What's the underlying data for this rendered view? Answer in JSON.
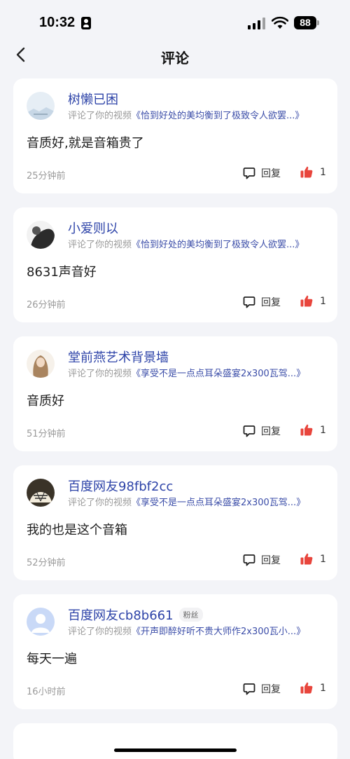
{
  "status": {
    "time": "10:32",
    "battery": "88"
  },
  "nav": {
    "title": "评论"
  },
  "comments": [
    {
      "user": "树懒已困",
      "badge": "",
      "action": "评论了你的视频",
      "video": "《恰到好处的美均衡到了极致令人欲罢...》",
      "text": "音质好,就是音箱贵了",
      "time": "25分钟前",
      "reply": "回复",
      "likes": "1"
    },
    {
      "user": "小爱则以",
      "badge": "",
      "action": "评论了你的视频",
      "video": "《恰到好处的美均衡到了极致令人欲罢...》",
      "text": "8631声音好",
      "time": "26分钟前",
      "reply": "回复",
      "likes": "1"
    },
    {
      "user": "堂前燕艺术背景墙",
      "badge": "",
      "action": "评论了你的视频",
      "video": "《享受不是一点点耳朵盛宴2x300瓦驾...》",
      "text": "音质好",
      "time": "51分钟前",
      "reply": "回复",
      "likes": "1"
    },
    {
      "user": "百度网友98fbf2cc",
      "badge": "",
      "action": "评论了你的视频",
      "video": "《享受不是一点点耳朵盛宴2x300瓦驾...》",
      "text": "我的也是这个音箱",
      "time": "52分钟前",
      "reply": "回复",
      "likes": "1"
    },
    {
      "user": "百度网友cb8b661",
      "badge": "粉丝",
      "action": "评论了你的视频",
      "video": "《开声即醉好听不贵大师作2x300瓦小...》",
      "text": "每天一遍",
      "time": "16小时前",
      "reply": "回复",
      "likes": "1"
    }
  ],
  "colors": {
    "link": "#3b4da8",
    "username": "#2d43a8",
    "like": "#e8453c",
    "background": "#f3f4f8"
  }
}
